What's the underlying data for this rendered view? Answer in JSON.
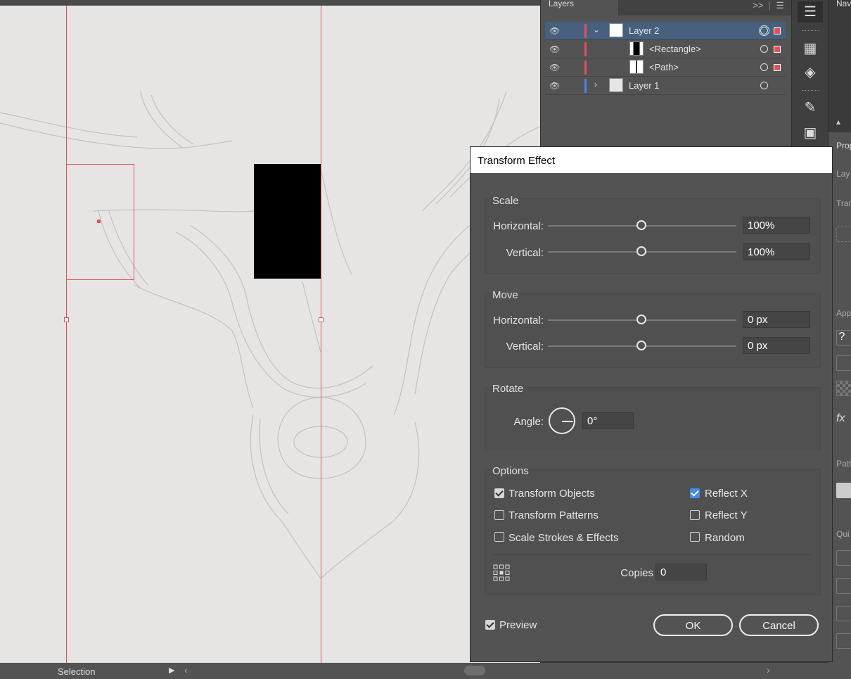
{
  "layers_panel": {
    "tab_label": "Layers",
    "collapse_icon": "double-chevron-right-icon",
    "menu_icon": "hamburger-menu-icon",
    "rows": [
      {
        "label": "Layer 2",
        "color": "#e0525a",
        "expanded": true,
        "selected": true
      },
      {
        "label": "<Rectangle>",
        "color": "#e0525a"
      },
      {
        "label": "<Path>",
        "color": "#e0525a"
      },
      {
        "label": "Layer 1",
        "color": "#4f82e8",
        "expanded": false
      }
    ]
  },
  "right_panel": {
    "navigator_label": "Nav",
    "properties_label": "Prop",
    "layer_label": "Lay",
    "transform_label": "Tran",
    "appearance_label": "App",
    "unknown_label": "?",
    "fx_label": "fx",
    "pathfinder_label": "Path",
    "quick_label": "Qui"
  },
  "dialog": {
    "title": "Transform Effect",
    "scale": {
      "title": "Scale",
      "horizontal_label": "Horizontal:",
      "horizontal_value": "100%",
      "horizontal_slider": 0.5,
      "vertical_label": "Vertical:",
      "vertical_value": "100%",
      "vertical_slider": 0.5
    },
    "move": {
      "title": "Move",
      "horizontal_label": "Horizontal:",
      "horizontal_value": "0 px",
      "vertical_label": "Vertical:",
      "vertical_value": "0 px"
    },
    "rotate": {
      "title": "Rotate",
      "angle_label": "Angle:",
      "angle_value": "0°"
    },
    "options": {
      "title": "Options",
      "transform_objects": {
        "label": "Transform Objects",
        "checked": true
      },
      "transform_patterns": {
        "label": "Transform Patterns",
        "checked": false
      },
      "scale_strokes": {
        "label": "Scale Strokes & Effects",
        "checked": false
      },
      "reflect_x": {
        "label": "Reflect X",
        "checked": true
      },
      "reflect_y": {
        "label": "Reflect Y",
        "checked": false
      },
      "random": {
        "label": "Random",
        "checked": false
      },
      "copies_label": "Copies",
      "copies_value": "0"
    },
    "preview": {
      "label": "Preview",
      "checked": true
    },
    "ok_label": "OK",
    "cancel_label": "Cancel"
  },
  "status_bar": {
    "tool_label": "Selection"
  }
}
